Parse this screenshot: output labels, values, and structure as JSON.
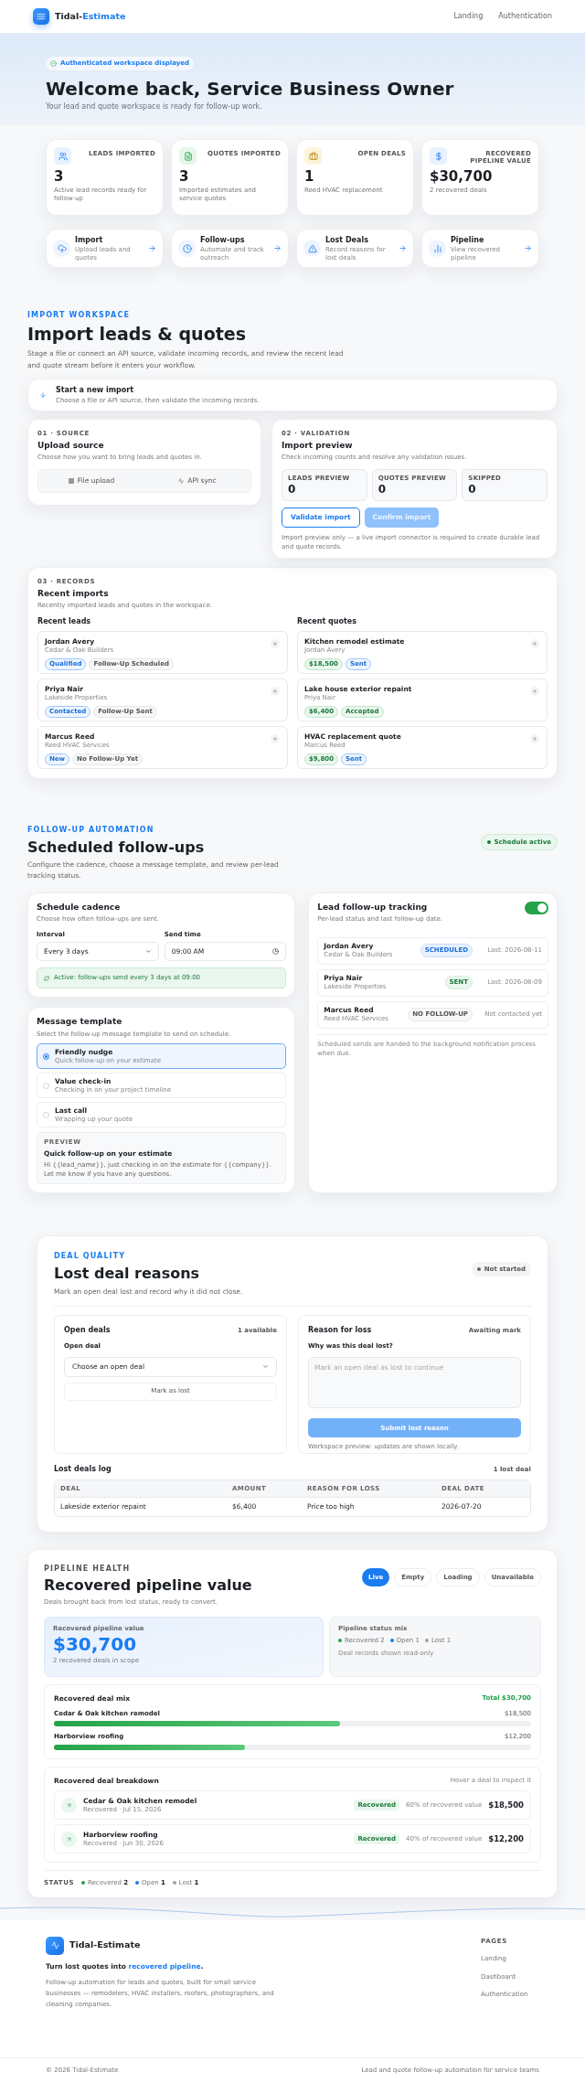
{
  "header": {
    "brand_prefix": "Tidal-",
    "brand_suffix": "Estimate",
    "nav": [
      "Landing",
      "Authentication"
    ]
  },
  "hero": {
    "badge": "Authenticated workspace displayed",
    "title": "Welcome back, Service Business Owner",
    "subtitle": "Your lead and quote workspace is ready for follow-up work."
  },
  "stats": [
    {
      "kind": "leads",
      "label": "LEADS IMPORTED",
      "value": "3",
      "note": "Active lead records ready for follow-up"
    },
    {
      "kind": "quotes",
      "label": "QUOTES IMPORTED",
      "value": "3",
      "note": "Imported estimates and service quotes"
    },
    {
      "kind": "deals",
      "label": "OPEN DEALS",
      "value": "1",
      "note": "Reed HVAC replacement"
    },
    {
      "kind": "value",
      "label": "RECOVERED PIPELINE VALUE",
      "value": "$30,700",
      "note": "2 recovered deals"
    }
  ],
  "shortcuts": [
    {
      "kind": "import",
      "title": "Import",
      "note": "Upload leads and quotes"
    },
    {
      "kind": "followups",
      "title": "Follow-ups",
      "note": "Automate and track outreach"
    },
    {
      "kind": "lost",
      "title": "Lost Deals",
      "note": "Record reasons for lost deals"
    },
    {
      "kind": "pipeline",
      "title": "Pipeline",
      "note": "View recovered pipeline"
    }
  ],
  "import": {
    "eyebrow": "IMPORT WORKSPACE",
    "title": "Import leads & quotes",
    "description": "Stage a file or connect an API source, validate incoming records, and review the recent lead and quote stream before it enters your workflow.",
    "start": {
      "title": "Start a new import",
      "note": "Choose a file or API source, then validate the incoming records."
    },
    "source": {
      "step": "01 · SOURCE",
      "title": "Upload source",
      "note": "Choose how you want to bring leads and quotes in.",
      "options": [
        {
          "kind": "file",
          "label": "File upload"
        },
        {
          "kind": "api",
          "label": "API sync"
        }
      ]
    },
    "validation": {
      "step": "02 · VALIDATION",
      "title": "Import preview",
      "note": "Check incoming counts and resolve any validation issues.",
      "counts": [
        {
          "label": "LEADS PREVIEW",
          "value": "0"
        },
        {
          "label": "QUOTES PREVIEW",
          "value": "0"
        },
        {
          "label": "SKIPPED",
          "value": "0"
        }
      ],
      "buttons": [
        {
          "label": "Validate import",
          "disabled": false
        },
        {
          "label": "Confirm import",
          "disabled": true
        }
      ],
      "footnote": "Import preview only — a live import connector is required to create durable lead and quote records."
    },
    "records": {
      "step": "03 · RECORDS",
      "title": "Recent imports",
      "note": "Recently imported leads and quotes in the workspace.",
      "columns": [
        {
          "title": "Recent leads",
          "items": [
            {
              "title": "Jordan Avery",
              "subtitle": "Cedar & Oak Builders",
              "tags": [
                {
                  "kind": "info",
                  "label": "Qualified"
                },
                {
                  "kind": "neutral",
                  "label": "Follow-Up Scheduled"
                }
              ]
            },
            {
              "title": "Priya Nair",
              "subtitle": "Lakeside Properties",
              "tags": [
                {
                  "kind": "info",
                  "label": "Contacted"
                },
                {
                  "kind": "neutral",
                  "label": "Follow-Up Sent"
                }
              ]
            },
            {
              "title": "Marcus Reed",
              "subtitle": "Reed HVAC Services",
              "tags": [
                {
                  "kind": "info",
                  "label": "New"
                },
                {
                  "kind": "neutral",
                  "label": "No Follow-Up Yet"
                }
              ]
            }
          ]
        },
        {
          "title": "Recent quotes",
          "items": [
            {
              "title": "Kitchen remodel estimate",
              "subtitle": "Jordan Avery",
              "tags": [
                {
                  "kind": "success",
                  "label": "$18,500"
                },
                {
                  "kind": "info",
                  "label": "Sent"
                }
              ]
            },
            {
              "title": "Lake house exterior repaint",
              "subtitle": "Priya Nair",
              "tags": [
                {
                  "kind": "success",
                  "label": "$6,400"
                },
                {
                  "kind": "success",
                  "label": "Accepted"
                }
              ]
            },
            {
              "title": "HVAC replacement quote",
              "subtitle": "Marcus Reed",
              "tags": [
                {
                  "kind": "success",
                  "label": "$9,800"
                },
                {
                  "kind": "info",
                  "label": "Sent"
                }
              ]
            }
          ]
        }
      ]
    }
  },
  "followups": {
    "eyebrow": "FOLLOW-UP AUTOMATION",
    "title": "Scheduled follow-ups",
    "description": "Configure the cadence, choose a message template, and review per-lead tracking status.",
    "status_badge": "Schedule active",
    "cadence": {
      "title": "Schedule cadence",
      "note": "Choose how often follow-ups are sent.",
      "interval_label": "Interval",
      "interval_value": "Every 3 days",
      "time_label": "Send time",
      "time_value": "09:00 AM",
      "active_note": "Active: follow-ups send every 3 days at 09:00"
    },
    "template": {
      "title": "Message template",
      "note": "Select the follow-up message template to send on schedule.",
      "options": [
        {
          "title": "Friendly nudge",
          "note": "Quick follow-up on your estimate",
          "selected": true
        },
        {
          "title": "Value check-in",
          "note": "Checking in on your project timeline",
          "selected": false
        },
        {
          "title": "Last call",
          "note": "Wrapping up your quote",
          "selected": false
        }
      ],
      "preview": {
        "label": "PREVIEW",
        "title": "Quick follow-up on your estimate",
        "body": "Hi {{lead_name}}, just checking in on the estimate for {{company}}. Let me know if you have any questions."
      }
    },
    "tracking": {
      "title": "Lead follow-up tracking",
      "note": "Per-lead status and last follow-up date.",
      "on": true,
      "rows": [
        {
          "name": "Jordan Avery",
          "company": "Cedar & Oak Builders",
          "status": "SCHEDULED",
          "kind": "scheduled",
          "last": "Last: 2026-08-11"
        },
        {
          "name": "Priya Nair",
          "company": "Lakeside Properties",
          "status": "SENT",
          "kind": "sent",
          "last": "Last: 2026-08-09"
        },
        {
          "name": "Marcus Reed",
          "company": "Reed HVAC Services",
          "status": "NO FOLLOW-UP",
          "kind": "none",
          "last": "Not contacted yet"
        }
      ],
      "footnote": "Scheduled sends are handed to the background notification process when due."
    }
  },
  "lost": {
    "eyebrow": "DEAL QUALITY",
    "title": "Lost deal reasons",
    "description": "Mark an open deal lost and record why it did not close.",
    "status": "Not started",
    "open_deals": {
      "title": "Open deals",
      "count": "1 available",
      "field_label": "Open deal",
      "select_value": "Choose an open deal",
      "button": "Mark as lost"
    },
    "reason": {
      "title": "Reason for loss",
      "status": "Awaiting mark",
      "field_label": "Why was this deal lost?",
      "placeholder": "Mark an open deal as lost to continue",
      "button": "Submit lost reason",
      "button_disabled": true,
      "note": "Workspace preview: updates are shown locally."
    },
    "log": {
      "title": "Lost deals log",
      "count": "1 lost deal",
      "columns": [
        "DEAL",
        "AMOUNT",
        "REASON FOR LOSS",
        "DEAL DATE"
      ],
      "rows": [
        [
          "Lakeside exterior repaint",
          "$6,400",
          "Price too high",
          "2026-07-20"
        ]
      ]
    }
  },
  "pipeline": {
    "eyebrow": "PIPELINE HEALTH",
    "title": "Recovered pipeline value",
    "description": "Deals brought back from lost status, ready to convert.",
    "tabs": [
      {
        "label": "Live",
        "selected": true
      },
      {
        "label": "Empty",
        "selected": false
      },
      {
        "label": "Loading",
        "selected": false
      },
      {
        "label": "Unavailable",
        "selected": false
      }
    ],
    "value_card": {
      "label": "Recovered pipeline value",
      "value": "$30,700",
      "note": "2 recovered deals in scope"
    },
    "status_mix": {
      "title": "Pipeline status mix",
      "items": [
        {
          "label": "Recovered 2",
          "color": "#22a34a"
        },
        {
          "label": "Open 1",
          "color": "#1a7cf0"
        },
        {
          "label": "Lost 1",
          "color": "#a3a3a3"
        }
      ],
      "note": "Deal records shown read-only"
    },
    "deal_mix": {
      "title": "Recovered deal mix",
      "total": "Total $30,700",
      "bars": [
        {
          "label": "Cedar & Oak kitchen remodel",
          "amount": "$18,500",
          "level": 0.6
        },
        {
          "label": "Harborview roofing",
          "amount": "$12,200",
          "level": 0.4
        }
      ]
    },
    "breakdown": {
      "title": "Recovered deal breakdown",
      "hint": "Hover a deal to inspect it",
      "rows": [
        {
          "title": "Cedar & Oak kitchen remodel",
          "date": "Recovered · Jul 15, 2026",
          "badge": "Recovered",
          "share": "60% of recovered value",
          "amount": "$18,500"
        },
        {
          "title": "Harborview roofing",
          "date": "Recovered · Jun 30, 2026",
          "badge": "Recovered",
          "share": "40% of recovered value",
          "amount": "$12,200"
        }
      ]
    },
    "status_bar": {
      "label": "STATUS",
      "items": [
        {
          "label": "Recovered",
          "count": "2",
          "color": "#22a34a"
        },
        {
          "label": "Open",
          "count": "1",
          "color": "#1a7cf0"
        },
        {
          "label": "Lost",
          "count": "1",
          "color": "#a3a3a3"
        }
      ]
    }
  },
  "footer": {
    "brand": "Tidal-Estimate",
    "tagline_prefix": "Turn lost quotes into ",
    "tagline_link": "recovered pipeline",
    "tagline_suffix": ".",
    "description": "Follow-up automation for leads and quotes, built for small service businesses — remodelers, HVAC installers, roofers, photographers, and cleaning companies.",
    "pages_title": "PAGES",
    "pages": [
      "Landing",
      "Dashboard",
      "Authentication"
    ],
    "copyright": "© 2026 Tidal-Estimate",
    "bottom_note": "Lead and quote follow-up automation for service teams"
  }
}
